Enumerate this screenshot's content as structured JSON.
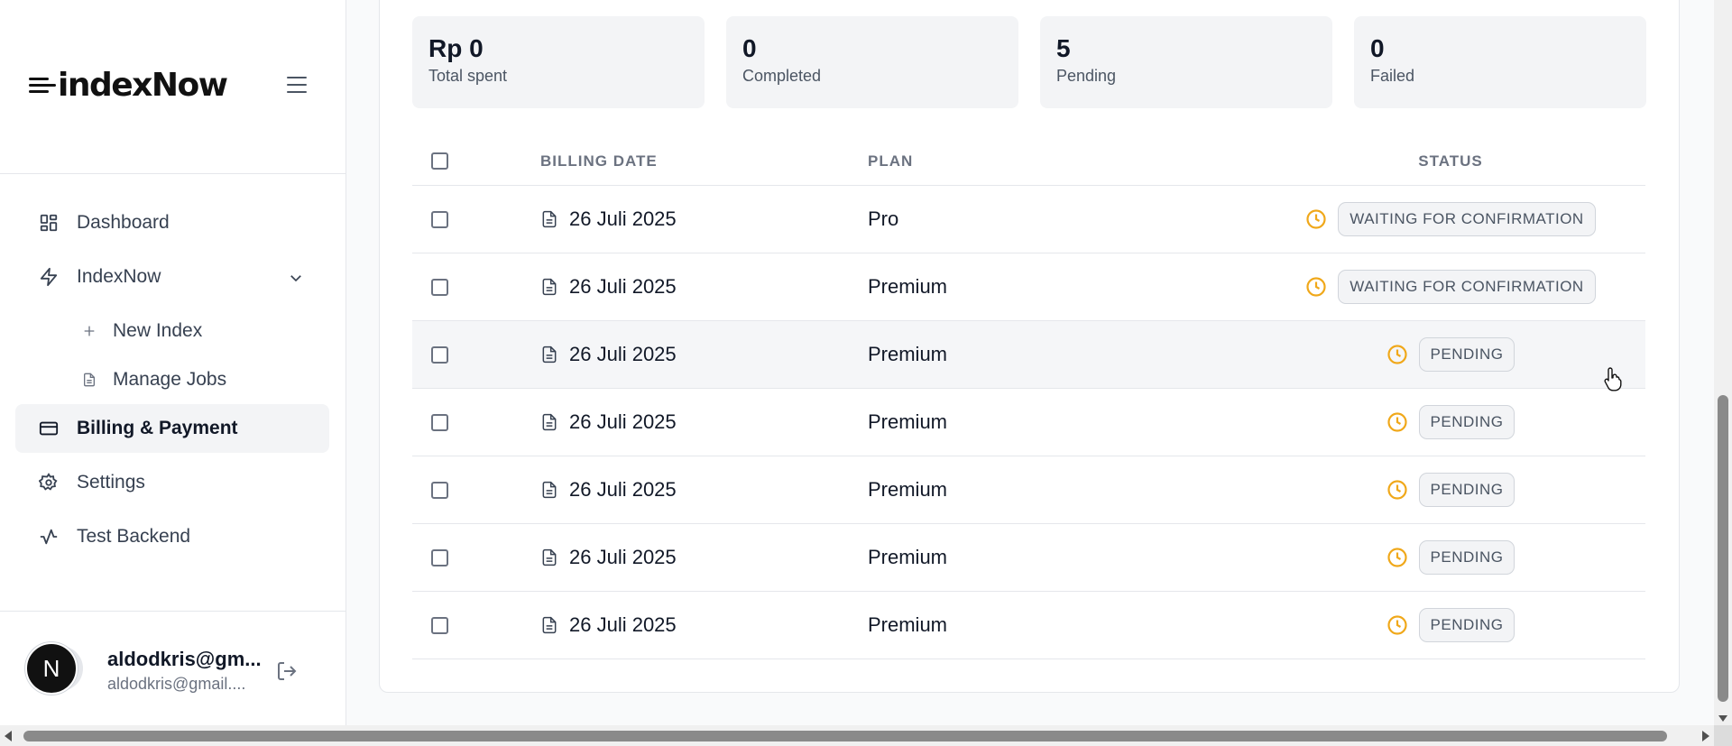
{
  "sidebar": {
    "logo": "indexNow",
    "nav": [
      {
        "label": "Dashboard",
        "icon": "dashboard-icon"
      },
      {
        "label": "IndexNow",
        "icon": "lightning-icon"
      },
      {
        "label": "New Index",
        "icon": "plus-icon"
      },
      {
        "label": "Manage Jobs",
        "icon": "file-icon"
      },
      {
        "label": "Billing & Payment",
        "icon": "credit-card-icon"
      },
      {
        "label": "Settings",
        "icon": "gear-icon"
      },
      {
        "label": "Test Backend",
        "icon": "activity-icon"
      }
    ],
    "user": {
      "initial": "N",
      "name": "aldodkris@gm...",
      "email": "aldodkris@gmail...."
    }
  },
  "stats": [
    {
      "value": "Rp 0",
      "label": "Total spent"
    },
    {
      "value": "0",
      "label": "Completed"
    },
    {
      "value": "5",
      "label": "Pending"
    },
    {
      "value": "0",
      "label": "Failed"
    }
  ],
  "table": {
    "headers": {
      "billing_date": "BILLING DATE",
      "plan": "PLAN",
      "status": "STATUS"
    },
    "rows": [
      {
        "date": "26 Juli 2025",
        "plan": "Pro",
        "status": "WAITING FOR CONFIRMATION"
      },
      {
        "date": "26 Juli 2025",
        "plan": "Premium",
        "status": "WAITING FOR CONFIRMATION"
      },
      {
        "date": "26 Juli 2025",
        "plan": "Premium",
        "status": "PENDING"
      },
      {
        "date": "26 Juli 2025",
        "plan": "Premium",
        "status": "PENDING"
      },
      {
        "date": "26 Juli 2025",
        "plan": "Premium",
        "status": "PENDING"
      },
      {
        "date": "26 Juli 2025",
        "plan": "Premium",
        "status": "PENDING"
      },
      {
        "date": "26 Juli 2025",
        "plan": "Premium",
        "status": "PENDING"
      }
    ]
  },
  "colors": {
    "pending_clock": "#f0a81a",
    "active_nav_bg": "#f3f4f6"
  }
}
